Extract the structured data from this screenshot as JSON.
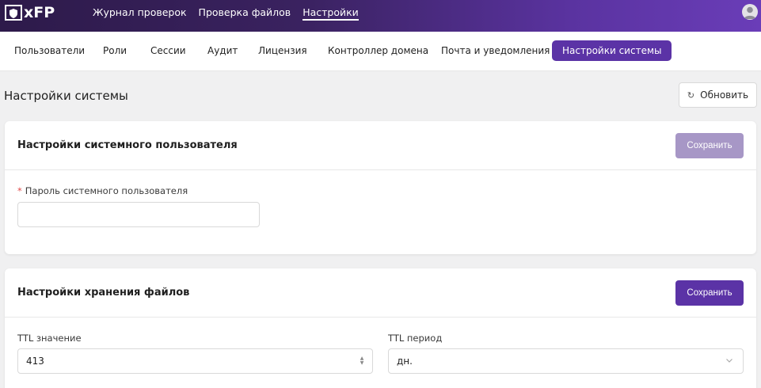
{
  "header": {
    "logo_text": "xFP",
    "nav": [
      {
        "label": "Журнал проверок"
      },
      {
        "label": "Проверка файлов"
      },
      {
        "label": "Настройки"
      }
    ],
    "active_nav_index": 2,
    "user_icon": "user-avatar-icon"
  },
  "tabs": [
    {
      "label": "Пользователи"
    },
    {
      "label": "Роли"
    },
    {
      "label": "Сессии"
    },
    {
      "label": "Аудит"
    },
    {
      "label": "Лицензия"
    },
    {
      "label": "Контроллер домена"
    },
    {
      "label": "Почта и уведомления"
    },
    {
      "label": "Настройки системы"
    }
  ],
  "active_tab_index": 7,
  "page": {
    "title": "Настройки системы",
    "refresh_label": "Обновить",
    "refresh_icon": "refresh-icon"
  },
  "system_user_card": {
    "title": "Настройки системного пользователя",
    "save_label": "Сохранить",
    "save_enabled": false,
    "password_label": "Пароль системного пользователя",
    "password_required": true,
    "password_value": ""
  },
  "storage_card": {
    "title": "Настройки хранения файлов",
    "save_label": "Сохранить",
    "save_enabled": true,
    "ttl_value_label": "TTL значение",
    "ttl_value": "413",
    "ttl_period_label": "TTL период",
    "ttl_period_value": "дн."
  },
  "colors": {
    "accent": "#5b33a6",
    "accent_disabled": "#a797c6",
    "required_mark": "#e04848"
  }
}
